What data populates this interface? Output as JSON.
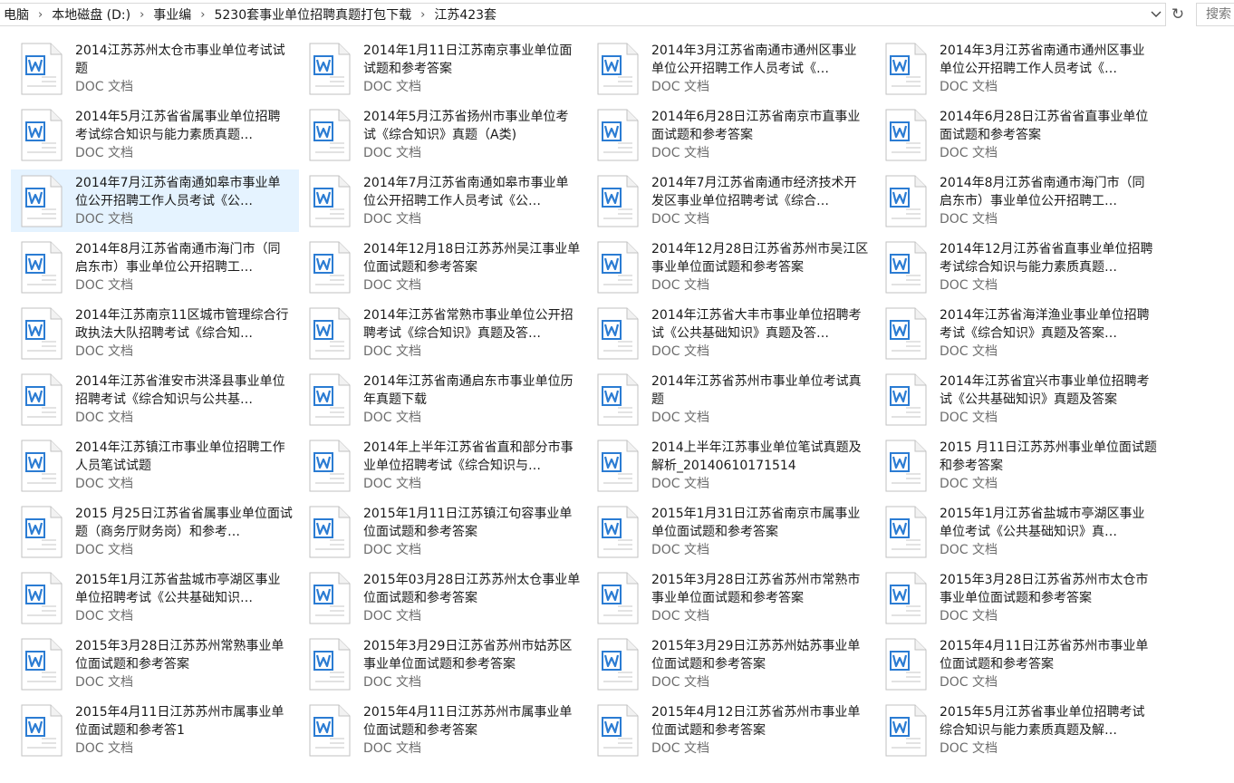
{
  "breadcrumb": [
    "电脑",
    "本地磁盘 (D:)",
    "事业编",
    "5230套事业单位招聘真题打包下载",
    "江苏423套"
  ],
  "search": {
    "placeholder": "搜索"
  },
  "icons": {
    "file": "word-doc-icon",
    "dropdown": "chevron-down-icon",
    "refresh": "refresh-icon",
    "separator": "chevron-right-icon"
  },
  "colors": {
    "selection": "#e5f3ff",
    "word_blue": "#2b7cd3"
  },
  "files": [
    {
      "name": "2014江苏苏州太仓市事业单位考试试题",
      "type": "DOC 文档"
    },
    {
      "name": "2014年1月11日江苏南京事业单位面试题和参考答案",
      "type": "DOC 文档"
    },
    {
      "name": "2014年3月江苏省南通市通州区事业单位公开招聘工作人员考试《…",
      "type": "DOC 文档"
    },
    {
      "name": "2014年3月江苏省南通市通州区事业单位公开招聘工作人员考试《…",
      "type": "DOC 文档"
    },
    {
      "name": "2014年5月江苏省省属事业单位招聘考试综合知识与能力素质真题…",
      "type": "DOC 文档"
    },
    {
      "name": "2014年5月江苏省扬州市事业单位考试《综合知识》真题（A类)",
      "type": "DOC 文档"
    },
    {
      "name": "2014年6月28日江苏省南京市直事业面试题和参考答案",
      "type": "DOC 文档"
    },
    {
      "name": "2014年6月28日江苏省省直事业单位面试题和参考答案",
      "type": "DOC 文档"
    },
    {
      "name": "2014年7月江苏省南通如皋市事业单位公开招聘工作人员考试《公…",
      "type": "DOC 文档",
      "selected": true
    },
    {
      "name": "2014年7月江苏省南通如皋市事业单位公开招聘工作人员考试《公…",
      "type": "DOC 文档"
    },
    {
      "name": "2014年7月江苏省南通市经济技术开发区事业单位招聘考试《综合…",
      "type": "DOC 文档"
    },
    {
      "name": "2014年8月江苏省南通市海门市（同启东市）事业单位公开招聘工…",
      "type": "DOC 文档"
    },
    {
      "name": "2014年8月江苏省南通市海门市（同启东市）事业单位公开招聘工…",
      "type": "DOC 文档"
    },
    {
      "name": "2014年12月18日江苏苏州吴江事业单位面试题和参考答案",
      "type": "DOC 文档"
    },
    {
      "name": "2014年12月28日江苏省苏州市吴江区事业单位面试题和参考答案",
      "type": "DOC 文档"
    },
    {
      "name": "2014年12月江苏省省直事业单位招聘考试综合知识与能力素质真题…",
      "type": "DOC 文档"
    },
    {
      "name": "2014年江苏南京11区城市管理综合行政执法大队招聘考试《综合知…",
      "type": "DOC 文档"
    },
    {
      "name": "2014年江苏省常熟市事业单位公开招聘考试《综合知识》真题及答…",
      "type": "DOC 文档"
    },
    {
      "name": "2014年江苏省大丰市事业单位招聘考试《公共基础知识》真题及答…",
      "type": "DOC 文档"
    },
    {
      "name": "2014年江苏省海洋渔业事业单位招聘考试《综合知识》真题及答案…",
      "type": "DOC 文档"
    },
    {
      "name": "2014年江苏省淮安市洪泽县事业单位招聘考试《综合知识与公共基…",
      "type": "DOC 文档"
    },
    {
      "name": "2014年江苏省南通启东市事业单位历年真题下载",
      "type": "DOC 文档"
    },
    {
      "name": "2014年江苏省苏州市事业单位考试真题",
      "type": "DOC 文档"
    },
    {
      "name": "2014年江苏省宜兴市事业单位招聘考试《公共基础知识》真题及答案",
      "type": "DOC 文档"
    },
    {
      "name": "2014年江苏镇江市事业单位招聘工作人员笔试试题",
      "type": "DOC 文档"
    },
    {
      "name": "2014年上半年江苏省省直和部分市事业单位招聘考试《综合知识与…",
      "type": "DOC 文档"
    },
    {
      "name": "2014上半年江苏事业单位笔试真题及解析_20140610171514",
      "type": "DOC 文档"
    },
    {
      "name": "2015 月11日江苏苏州事业单位面试题和参考答案",
      "type": "DOC 文档"
    },
    {
      "name": "2015 月25日江苏省省属事业单位面试题（商务厅财务岗）和参考…",
      "type": "DOC 文档"
    },
    {
      "name": "2015年1月11日江苏镇江句容事业单位面试题和参考答案",
      "type": "DOC 文档"
    },
    {
      "name": "2015年1月31日江苏省南京市属事业单位面试题和参考答案",
      "type": "DOC 文档"
    },
    {
      "name": "2015年1月江苏省盐城市亭湖区事业单位考试《公共基础知识》真…",
      "type": "DOC 文档"
    },
    {
      "name": "2015年1月江苏省盐城市亭湖区事业单位招聘考试《公共基础知识…",
      "type": "DOC 文档"
    },
    {
      "name": "2015年03月28日江苏苏州太仓事业单位面试题和参考答案",
      "type": "DOC 文档"
    },
    {
      "name": "2015年3月28日江苏省苏州市常熟市事业单位面试题和参考答案",
      "type": "DOC 文档"
    },
    {
      "name": "2015年3月28日江苏省苏州市太仓市事业单位面试题和参考答案",
      "type": "DOC 文档"
    },
    {
      "name": "2015年3月28日江苏苏州常熟事业单位面试题和参考答案",
      "type": "DOC 文档"
    },
    {
      "name": "2015年3月29日江苏省苏州市姑苏区事业单位面试题和参考答案",
      "type": "DOC 文档"
    },
    {
      "name": "2015年3月29日江苏苏州姑苏事业单位面试题和参考答案",
      "type": "DOC 文档"
    },
    {
      "name": "2015年4月11日江苏省苏州市事业单位面试题和参考答案",
      "type": "DOC 文档"
    },
    {
      "name": "2015年4月11日江苏苏州市属事业单位面试题和参考答1",
      "type": "DOC 文档"
    },
    {
      "name": "2015年4月11日江苏苏州市属事业单位面试题和参考答案",
      "type": "DOC 文档"
    },
    {
      "name": "2015年4月12日江苏省苏州市事业单位面试题和参考答案",
      "type": "DOC 文档"
    },
    {
      "name": "2015年5月江苏省事业单位招聘考试综合知识与能力素质真题及解…",
      "type": "DOC 文档"
    }
  ]
}
